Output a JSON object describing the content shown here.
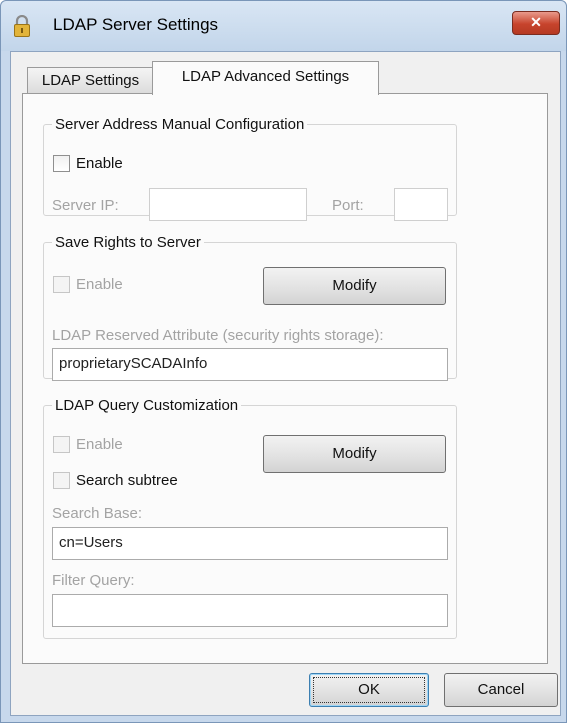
{
  "window": {
    "title": "LDAP Server Settings",
    "title_icon": "lock-icon",
    "close_glyph": "✕"
  },
  "tabs": [
    {
      "label": "LDAP Settings",
      "active": false
    },
    {
      "label": "LDAP Advanced Settings",
      "active": true
    }
  ],
  "server_address": {
    "legend": "Server Address Manual Configuration",
    "enable_label": "Enable",
    "enable_checked": false,
    "server_ip_label": "Server IP:",
    "server_ip_value": "",
    "port_label": "Port:",
    "port_value": ""
  },
  "save_rights": {
    "legend": "Save Rights to Server",
    "enable_label": "Enable",
    "enable_checked": false,
    "modify_label": "Modify",
    "reserved_attr_label": "LDAP Reserved Attribute (security rights storage):",
    "reserved_attr_value": "proprietarySCADAInfo"
  },
  "query_customization": {
    "legend": "LDAP Query Customization",
    "enable_label": "Enable",
    "enable_checked": false,
    "search_subtree_label": "Search subtree",
    "search_subtree_checked": false,
    "modify_label": "Modify",
    "search_base_label": "Search Base:",
    "search_base_value": "cn=Users",
    "filter_query_label": "Filter Query:",
    "filter_query_value": ""
  },
  "footer": {
    "ok_label": "OK",
    "cancel_label": "Cancel"
  },
  "colors": {
    "frame": "#c7d8ec",
    "close_button": "#c7432c",
    "disabled_text": "#a3a3a3"
  }
}
